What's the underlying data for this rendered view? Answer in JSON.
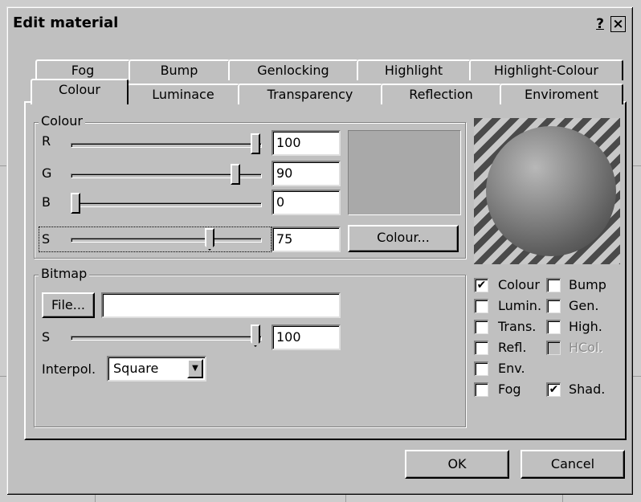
{
  "dialog": {
    "title": "Edit material",
    "help_label": "?",
    "close_label": "×"
  },
  "tabs": {
    "row_back": [
      "Fog",
      "Bump",
      "Genlocking",
      "Highlight",
      "Highlight-Colour"
    ],
    "row_front": [
      "Colour",
      "Luminace",
      "Transparency",
      "Reflection",
      "Enviroment"
    ],
    "active": "Colour"
  },
  "colour_group": {
    "label": "Colour",
    "sliders": [
      {
        "label": "R",
        "value": "100"
      },
      {
        "label": "G",
        "value": "90"
      },
      {
        "label": "B",
        "value": "0"
      },
      {
        "label": "S",
        "value": "75"
      }
    ],
    "swatch_color": "#a9a9a9",
    "colour_button": "Colour..."
  },
  "bitmap_group": {
    "label": "Bitmap",
    "file_button": "File...",
    "file_value": "",
    "s_label": "S",
    "s_value": "100",
    "interpol_label": "Interpol.",
    "interpol_value": "Square",
    "interpol_arrow": "▼"
  },
  "checkboxes": [
    {
      "label": "Colour",
      "checked": true
    },
    {
      "label": "Bump",
      "checked": false
    },
    {
      "label": "Lumin.",
      "checked": false
    },
    {
      "label": "Gen.",
      "checked": false
    },
    {
      "label": "Trans.",
      "checked": false
    },
    {
      "label": "High.",
      "checked": false
    },
    {
      "label": "Refl.",
      "checked": false
    },
    {
      "label": "HCol.",
      "checked": false,
      "disabled": true
    },
    {
      "label": "Env.",
      "checked": false
    },
    {
      "label": "Fog",
      "checked": false
    },
    {
      "label": "Shad.",
      "checked": true
    }
  ],
  "check_mark": "✔",
  "footer": {
    "ok_label": "OK",
    "cancel_label": "Cancel"
  }
}
